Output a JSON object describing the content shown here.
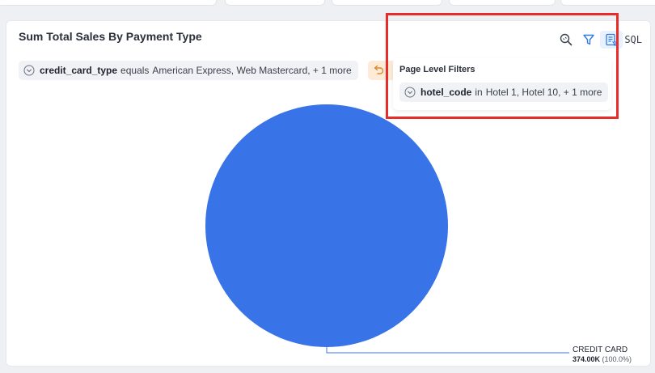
{
  "chart": {
    "title": "Sum Total Sales By Payment Type",
    "sql_label": "SQL"
  },
  "toolbar": {
    "icons": [
      "zoom-search-icon",
      "filter-icon",
      "page-filters-icon"
    ]
  },
  "filter": {
    "key": "credit_card_type",
    "operator": "equals",
    "values": "American Express, Web Mastercard, + 1 more"
  },
  "popover": {
    "title": "Page Level Filters",
    "key": "hotel_code",
    "operator": "in",
    "values": "Hotel 1, Hotel 10, + 1 more"
  },
  "colors": {
    "slice": "#3874e8",
    "highlight": "#e82b2b",
    "undo_bg": "#fdebd7",
    "undo_icon": "#d98a2b"
  },
  "chart_data": {
    "type": "pie",
    "title": "Sum Total Sales By Payment Type",
    "slices": [
      {
        "name": "CREDIT CARD",
        "value": 374000,
        "value_label": "374.00K",
        "percent_label": "(100.0%)"
      }
    ]
  }
}
